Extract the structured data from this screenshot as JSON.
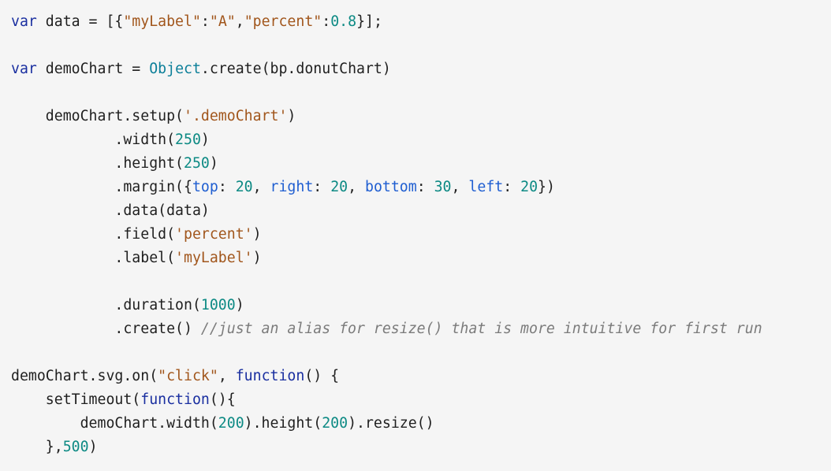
{
  "theme": {
    "background": "#f5f5f5",
    "text": "#1f1f1f",
    "keyword": "#1a2fa0",
    "function": "#0c7f99",
    "string": "#a1561c",
    "number": "#0d8a84",
    "property": "#1f5ed1",
    "comment": "#7b7b7b"
  },
  "code_lines": [
    [
      {
        "t": "kw",
        "v": "var"
      },
      {
        "t": "plain",
        "v": " data = [{"
      },
      {
        "t": "str",
        "v": "\"myLabel\""
      },
      {
        "t": "plain",
        "v": ":"
      },
      {
        "t": "str",
        "v": "\"A\""
      },
      {
        "t": "plain",
        "v": ","
      },
      {
        "t": "str",
        "v": "\"percent\""
      },
      {
        "t": "plain",
        "v": ":"
      },
      {
        "t": "num",
        "v": "0.8"
      },
      {
        "t": "plain",
        "v": "}];"
      }
    ],
    [],
    [
      {
        "t": "kw",
        "v": "var"
      },
      {
        "t": "plain",
        "v": " demoChart = "
      },
      {
        "t": "fn",
        "v": "Object"
      },
      {
        "t": "plain",
        "v": ".create(bp.donutChart)"
      }
    ],
    [],
    [
      {
        "t": "plain",
        "v": "    demoChart.setup("
      },
      {
        "t": "str",
        "v": "'.demoChart'"
      },
      {
        "t": "plain",
        "v": ")"
      }
    ],
    [
      {
        "t": "plain",
        "v": "            .width("
      },
      {
        "t": "num",
        "v": "250"
      },
      {
        "t": "plain",
        "v": ")"
      }
    ],
    [
      {
        "t": "plain",
        "v": "            .height("
      },
      {
        "t": "num",
        "v": "250"
      },
      {
        "t": "plain",
        "v": ")"
      }
    ],
    [
      {
        "t": "plain",
        "v": "            .margin({"
      },
      {
        "t": "prop",
        "v": "top"
      },
      {
        "t": "plain",
        "v": ": "
      },
      {
        "t": "num",
        "v": "20"
      },
      {
        "t": "plain",
        "v": ", "
      },
      {
        "t": "prop",
        "v": "right"
      },
      {
        "t": "plain",
        "v": ": "
      },
      {
        "t": "num",
        "v": "20"
      },
      {
        "t": "plain",
        "v": ", "
      },
      {
        "t": "prop",
        "v": "bottom"
      },
      {
        "t": "plain",
        "v": ": "
      },
      {
        "t": "num",
        "v": "30"
      },
      {
        "t": "plain",
        "v": ", "
      },
      {
        "t": "prop",
        "v": "left"
      },
      {
        "t": "plain",
        "v": ": "
      },
      {
        "t": "num",
        "v": "20"
      },
      {
        "t": "plain",
        "v": "})"
      }
    ],
    [
      {
        "t": "plain",
        "v": "            .data(data)"
      }
    ],
    [
      {
        "t": "plain",
        "v": "            .field("
      },
      {
        "t": "str",
        "v": "'percent'"
      },
      {
        "t": "plain",
        "v": ")"
      }
    ],
    [
      {
        "t": "plain",
        "v": "            .label("
      },
      {
        "t": "str",
        "v": "'myLabel'"
      },
      {
        "t": "plain",
        "v": ")"
      }
    ],
    [],
    [
      {
        "t": "plain",
        "v": "            .duration("
      },
      {
        "t": "num",
        "v": "1000"
      },
      {
        "t": "plain",
        "v": ")"
      }
    ],
    [
      {
        "t": "plain",
        "v": "            .create() "
      },
      {
        "t": "com",
        "v": "//just an alias for resize() that is more intuitive for first run"
      }
    ],
    [],
    [
      {
        "t": "plain",
        "v": "demoChart.svg.on("
      },
      {
        "t": "str",
        "v": "\"click\""
      },
      {
        "t": "plain",
        "v": ", "
      },
      {
        "t": "kw",
        "v": "function"
      },
      {
        "t": "plain",
        "v": "() {"
      }
    ],
    [
      {
        "t": "plain",
        "v": "    setTimeout("
      },
      {
        "t": "kw",
        "v": "function"
      },
      {
        "t": "plain",
        "v": "(){"
      }
    ],
    [
      {
        "t": "plain",
        "v": "        demoChart.width("
      },
      {
        "t": "num",
        "v": "200"
      },
      {
        "t": "plain",
        "v": ").height("
      },
      {
        "t": "num",
        "v": "200"
      },
      {
        "t": "plain",
        "v": ").resize()"
      }
    ],
    [
      {
        "t": "plain",
        "v": "    },"
      },
      {
        "t": "num",
        "v": "500"
      },
      {
        "t": "plain",
        "v": ")"
      }
    ]
  ]
}
